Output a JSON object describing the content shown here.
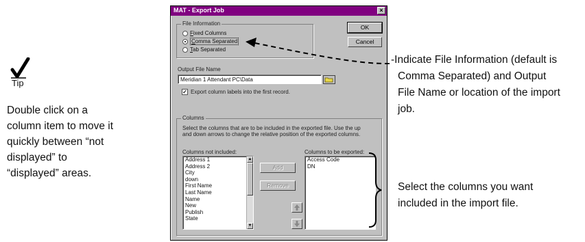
{
  "tip": {
    "label": "Tip",
    "lines": [
      "Double click on a",
      "column item to move it",
      "quickly between “not",
      "displayed” to",
      "“displayed” areas."
    ]
  },
  "dialog": {
    "title": "MAT - Export Job",
    "close_label": "×",
    "file_info": {
      "group_label": "File Information",
      "options": [
        {
          "prefix": "",
          "accel": "F",
          "rest": "ixed Columns",
          "selected": false
        },
        {
          "prefix": "",
          "accel": "C",
          "rest": "omma Separated",
          "selected": true
        },
        {
          "prefix": "",
          "accel": "T",
          "rest": "ab Separated",
          "selected": false
        }
      ]
    },
    "ok_label": "OK",
    "cancel_label": "Cancel",
    "output_file": {
      "label": "Output File Name",
      "value": "Meridian 1 Attendant PC\\Data",
      "folder_icon": "folder-icon"
    },
    "export_labels": {
      "checked": true,
      "label": "Export column labels into the first record."
    },
    "columns": {
      "group_label": "Columns",
      "description": "Select the columns that are to be included in the exported file. Use the up and down arrows to change the relative position of the exported columns.",
      "not_included_label": "Columns not included:",
      "not_included": [
        "Address 1",
        "Address 2",
        "City",
        "down",
        "First Name",
        "Last Name",
        "Name",
        "New",
        "Publish",
        "State"
      ],
      "to_export_label": "Columns to be exported:",
      "to_export": [
        "Access Code",
        "DN"
      ],
      "add_label": "Add",
      "remove_label": "Remove",
      "up_icon": "up-arrow-icon",
      "down_icon": "down-arrow-icon"
    }
  },
  "annotations": {
    "file_info": [
      "-Indicate File Information (default is",
      "Comma Separated) and Output",
      "File Name or location of the import",
      "job."
    ],
    "columns": [
      "Select the columns you want",
      "included in the import file."
    ]
  }
}
